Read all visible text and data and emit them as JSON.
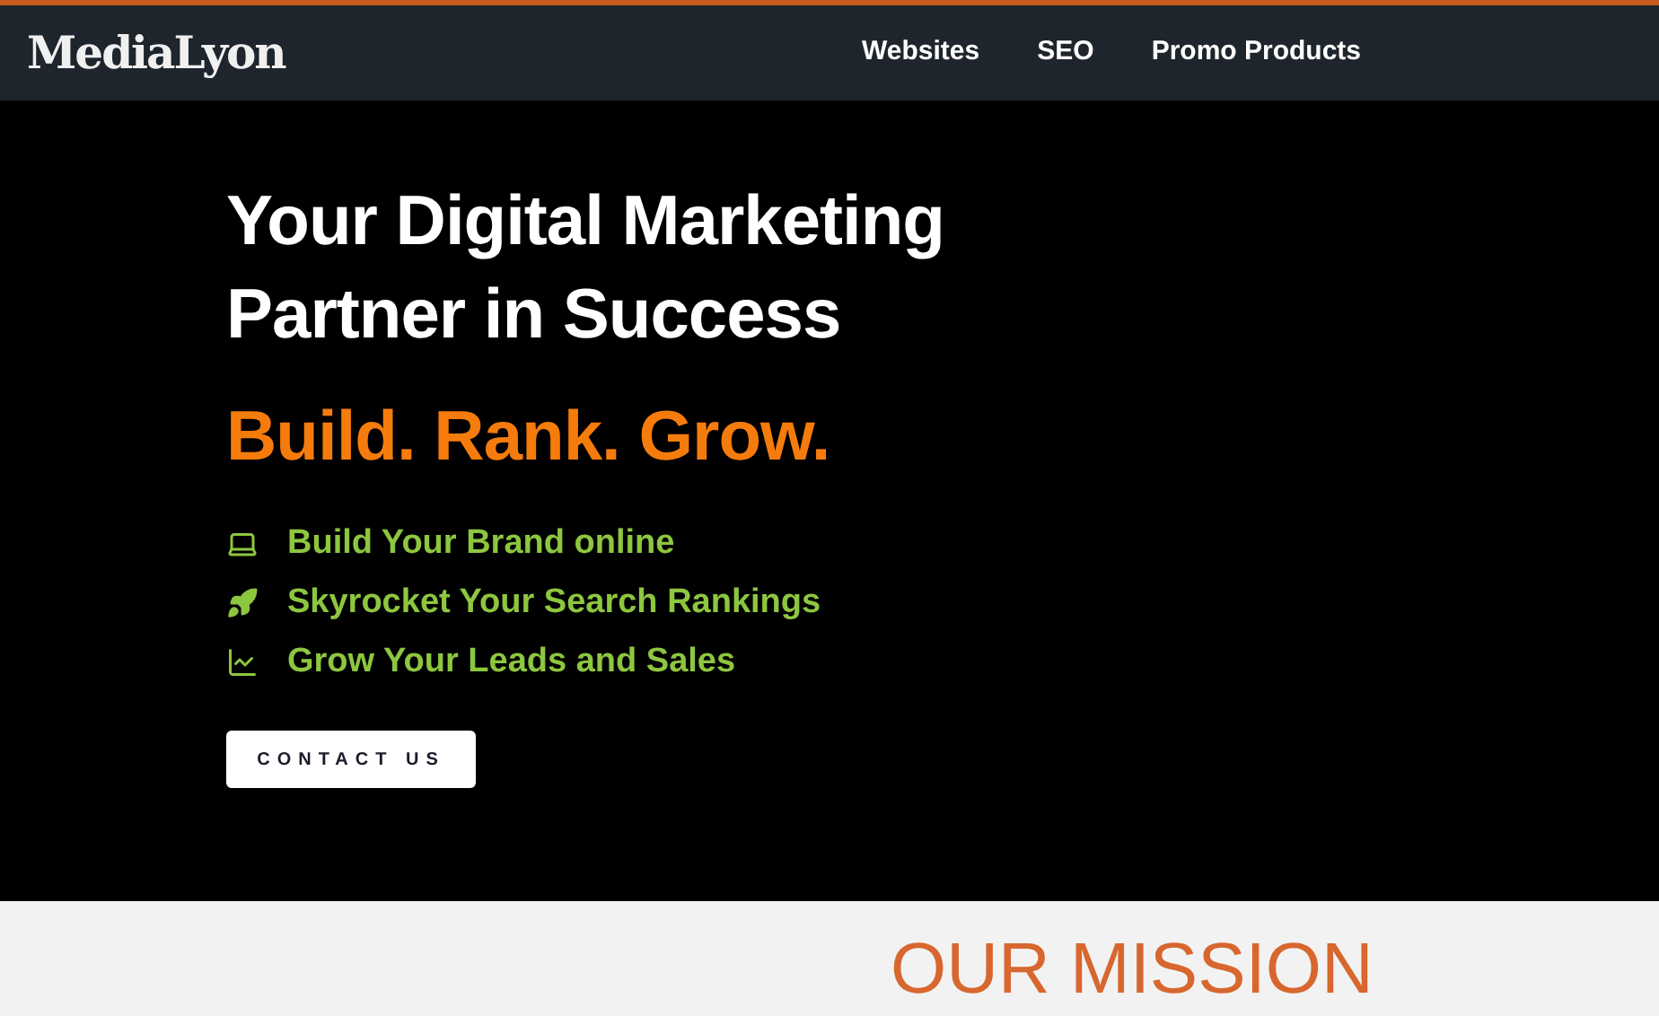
{
  "header": {
    "logo": "MediaLyon",
    "nav": [
      "Websites",
      "SEO",
      "Promo Products"
    ]
  },
  "hero": {
    "headline_lines": [
      "Your Digital Marketing",
      "Partner in Success"
    ],
    "tagline": "Build. Rank. Grow.",
    "features": [
      {
        "kind": "laptop",
        "text": "Build Your Brand online"
      },
      {
        "kind": "rocket",
        "text": "Skyrocket Your Search Rankings"
      },
      {
        "kind": "chart",
        "text": "Grow Your Leads and Sales"
      }
    ],
    "button": "CONTACT US"
  },
  "mission": {
    "title": "OUR MISSION"
  }
}
